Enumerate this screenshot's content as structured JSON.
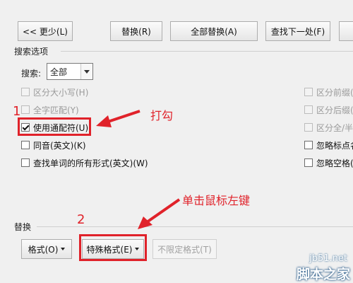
{
  "buttons": {
    "less": "<< 更少(L)",
    "replace": "替换(R)",
    "replace_all": "全部替换(A)",
    "find_next": "查找下一处(F)"
  },
  "search_options": {
    "legend": "搜索选项",
    "search_label": "搜索:",
    "search_value": "全部",
    "left_options": [
      {
        "label": "区分大小写(H)",
        "checked": false,
        "disabled": true
      },
      {
        "label": "全字匹配(Y)",
        "checked": false,
        "disabled": true
      },
      {
        "label": "使用通配符(U)",
        "checked": true,
        "disabled": false
      },
      {
        "label": "同音(英文)(K)",
        "checked": false,
        "disabled": false
      },
      {
        "label": "查找单词的所有形式(英文)(W)",
        "checked": false,
        "disabled": false
      }
    ],
    "right_options": [
      {
        "label": "区分前缀(",
        "checked": false,
        "disabled": true
      },
      {
        "label": "区分后缀(",
        "checked": false,
        "disabled": true
      },
      {
        "label": "区分全/半",
        "checked": false,
        "disabled": true
      },
      {
        "label": "忽略标点名",
        "checked": false,
        "disabled": false
      },
      {
        "label": "忽略空格(",
        "checked": false,
        "disabled": false
      }
    ]
  },
  "replace_section": {
    "legend": "替换",
    "format_button": "格式(O)",
    "special_format_button": "特殊格式(E)",
    "no_format_button": "不限定格式(T)"
  },
  "annotations": {
    "step1_number": "1",
    "step1_text": "打勾",
    "step2_number": "2",
    "step2_text": "单击鼠标左键"
  },
  "watermark": {
    "site": "jb51.net",
    "name": "脚本之家"
  },
  "colors": {
    "annotation_red": "#e0222a",
    "dialog_bg": "#f0f0f0"
  }
}
